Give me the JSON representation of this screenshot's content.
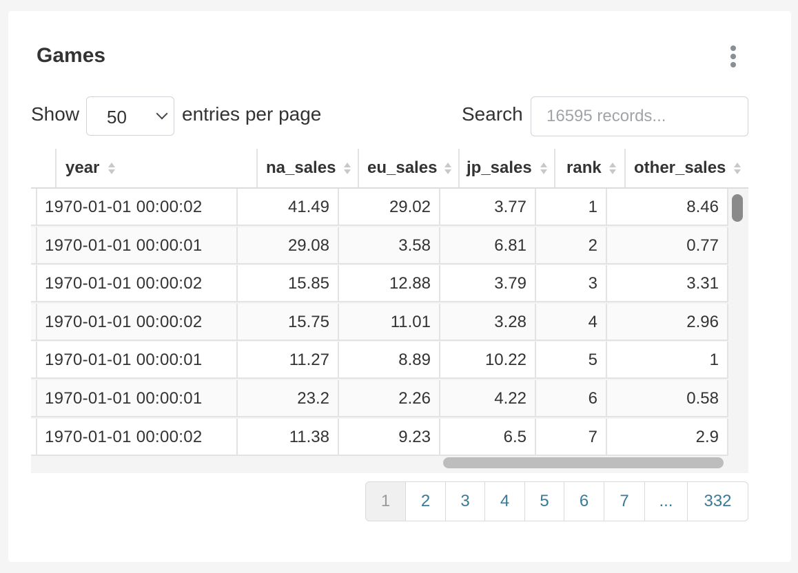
{
  "panel": {
    "title": "Games",
    "menu_icon": "kebab-vertical-icon"
  },
  "controls": {
    "show_label": "Show",
    "page_size": "50",
    "per_page_label": "entries per page",
    "search_label": "Search",
    "search_placeholder": "16595 records..."
  },
  "table": {
    "columns": [
      "year",
      "na_sales",
      "eu_sales",
      "jp_sales",
      "rank",
      "other_sales"
    ],
    "rows": [
      [
        "1970-01-01 00:00:02",
        "41.49",
        "29.02",
        "3.77",
        "1",
        "8.46"
      ],
      [
        "1970-01-01 00:00:01",
        "29.08",
        "3.58",
        "6.81",
        "2",
        "0.77"
      ],
      [
        "1970-01-01 00:00:02",
        "15.85",
        "12.88",
        "3.79",
        "3",
        "3.31"
      ],
      [
        "1970-01-01 00:00:02",
        "15.75",
        "11.01",
        "3.28",
        "4",
        "2.96"
      ],
      [
        "1970-01-01 00:00:01",
        "11.27",
        "8.89",
        "10.22",
        "5",
        "1"
      ],
      [
        "1970-01-01 00:00:01",
        "23.2",
        "2.26",
        "4.22",
        "6",
        "0.58"
      ],
      [
        "1970-01-01 00:00:02",
        "11.38",
        "9.23",
        "6.5",
        "7",
        "2.9"
      ]
    ]
  },
  "pagination": {
    "current": "1",
    "pages": [
      "1",
      "2",
      "3",
      "4",
      "5",
      "6",
      "7",
      "...",
      "332"
    ]
  }
}
